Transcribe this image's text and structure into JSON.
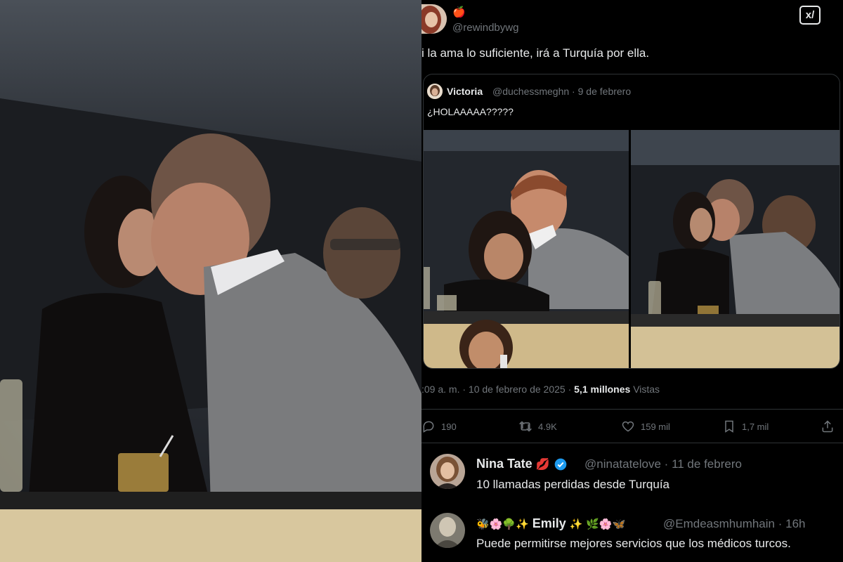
{
  "left_photo": {
    "description_icon": "photo-kiss-scene"
  },
  "tweet": {
    "author_emoji": "🍎",
    "handle": "@rewindbywg",
    "grok_label": "x/",
    "text": "i la ama lo suficiente, irá a Turquía por ella.",
    "quote": {
      "name": "Victoria",
      "handle": "@duchessmeghn",
      "date": "9 de febrero",
      "text": "¿HOLAAAAA?????"
    },
    "timestamp": ":09 a. m. · 10 de febrero de 2025 ·",
    "views_count": "5,1 millones",
    "views_label": "Vistas",
    "actions": {
      "replies": "190",
      "reposts": "4.9K",
      "likes": "159 mil",
      "bookmarks": "1,7 mil"
    }
  },
  "replies": [
    {
      "name": "Nina Tate",
      "name_emoji": "💋",
      "handle": "@ninatatelove",
      "date": "11 de febrero",
      "text": "10 llamadas perdidas desde Turquía"
    },
    {
      "name_prefix_emojis": "🐝🌸🌳✨",
      "name": "Emily",
      "name_suffix_emojis": "✨ 🌿🌸🦋",
      "handle": "@Emdeasmhumhain",
      "date": "16h",
      "text": "Puede permitirse mejores servicios que los médicos turcos."
    }
  ],
  "colors": {
    "background": "#000000",
    "text_primary": "#e7e9ea",
    "text_secondary": "#71767b",
    "border": "#2f3336",
    "verified_blue": "#1d9bf0"
  }
}
